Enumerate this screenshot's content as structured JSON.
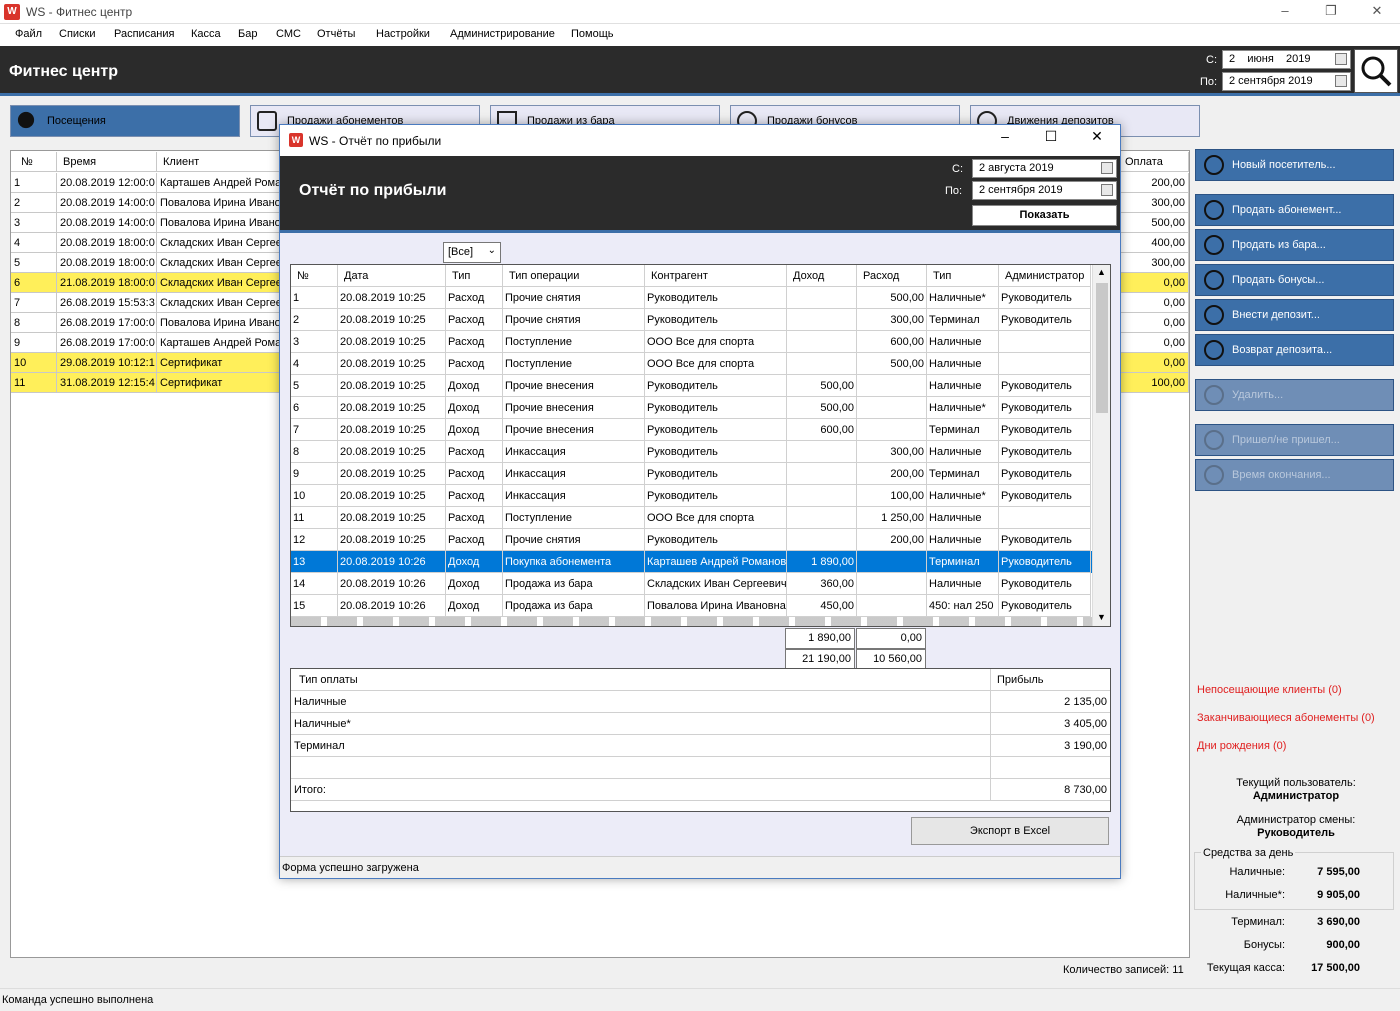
{
  "window": {
    "title": "WS - Фитнес центр",
    "logo": "W"
  },
  "menu": [
    "Файл",
    "Списки",
    "Расписания",
    "Касса",
    "Бар",
    "СМС",
    "Отчёты",
    "Настройки",
    "Администрирование",
    "Помощь"
  ],
  "header": {
    "title": "Фитнес центр",
    "from_label": "С:",
    "to_label": "По:",
    "from_day": "2",
    "from_month": "июня",
    "from_year": "2019",
    "to_date": "2 сентября 2019",
    "search_icon": "search-icon"
  },
  "tabs": [
    {
      "label": "Посещения",
      "icon": "visitor-icon",
      "active": true
    },
    {
      "label": "Продажи абонементов",
      "icon": "membership-card-icon"
    },
    {
      "label": "Продажи из бара",
      "icon": "coffee-cup-icon"
    },
    {
      "label": "Продажи бонусов",
      "icon": "dollar-coin-icon"
    },
    {
      "label": "Движения депозитов",
      "icon": "dollar-coin-icon"
    }
  ],
  "main_table": {
    "headers": [
      "№",
      "Время",
      "Клиент",
      "Оплата"
    ],
    "rows": [
      {
        "n": "1",
        "time": "20.08.2019 12:00:0",
        "client": "Карташев Андрей Рома",
        "pay": "200,00",
        "hl": false
      },
      {
        "n": "2",
        "time": "20.08.2019 14:00:0",
        "client": "Повалова Ирина Ивано",
        "pay": "300,00",
        "hl": false
      },
      {
        "n": "3",
        "time": "20.08.2019 14:00:0",
        "client": "Повалова Ирина Ивано",
        "pay": "500,00",
        "hl": false
      },
      {
        "n": "4",
        "time": "20.08.2019 18:00:0",
        "client": "Складских Иван Сергее",
        "pay": "400,00",
        "hl": false
      },
      {
        "n": "5",
        "time": "20.08.2019 18:00:0",
        "client": "Складских Иван Сергее",
        "pay": "300,00",
        "hl": false
      },
      {
        "n": "6",
        "time": "21.08.2019 18:00:0",
        "client": "Складских Иван Сергее",
        "pay": "0,00",
        "hl": true
      },
      {
        "n": "7",
        "time": "26.08.2019 15:53:3",
        "client": "Складских Иван Сергее",
        "pay": "0,00",
        "hl": false
      },
      {
        "n": "8",
        "time": "26.08.2019 17:00:0",
        "client": "Повалова Ирина Ивано",
        "pay": "0,00",
        "hl": false
      },
      {
        "n": "9",
        "time": "26.08.2019 17:00:0",
        "client": "Карташев Андрей Рома",
        "pay": "0,00",
        "hl": false
      },
      {
        "n": "10",
        "time": "29.08.2019 10:12:1",
        "client": "Сертификат",
        "pay": "0,00",
        "hl": true
      },
      {
        "n": "11",
        "time": "31.08.2019 12:15:4",
        "client": "Сертификат",
        "pay": "100,00",
        "hl": true
      }
    ],
    "record_count": "Количество записей: 11"
  },
  "sidebar": {
    "buttons": [
      {
        "label": "Новый посетитель...",
        "icon": "visitor-icon",
        "enabled": true
      },
      {
        "label": "Продать абонемент...",
        "icon": "membership-card-icon",
        "enabled": true
      },
      {
        "label": "Продать из бара...",
        "icon": "coffee-cup-icon",
        "enabled": true
      },
      {
        "label": "Продать бонусы...",
        "icon": "dollar-coin-icon",
        "enabled": true
      },
      {
        "label": "Внести депозит...",
        "icon": "deposit-in-icon",
        "enabled": true
      },
      {
        "label": "Возврат депозита...",
        "icon": "deposit-out-icon",
        "enabled": true
      },
      {
        "label": "Удалить...",
        "icon": "trash-icon",
        "enabled": false
      },
      {
        "label": "Пришел/не пришел...",
        "icon": "question-person-icon",
        "enabled": false
      },
      {
        "label": "Время окончания...",
        "icon": "clock-icon",
        "enabled": false
      }
    ],
    "links": [
      "Непосещающие клиенты (0)",
      "Заканчивающиеся абонементы (0)",
      "Дни рождения (0)"
    ],
    "user_label": "Текущий пользователь:",
    "user": "Администратор",
    "shift_label": "Администратор смены:",
    "shift_admin": "Руководитель",
    "funds_title": "Средства за день",
    "funds": [
      {
        "label": "Наличные:",
        "value": "7 595,00"
      },
      {
        "label": "Наличные*:",
        "value": "9 905,00"
      },
      {
        "label": "Терминал:",
        "value": "3 690,00"
      },
      {
        "label": "Бонусы:",
        "value": "900,00"
      },
      {
        "label": "Текущая касса:",
        "value": "17 500,00"
      }
    ]
  },
  "status": "Команда успешно выполнена",
  "dialog": {
    "title": "WS - Отчёт по прибыли",
    "heading": "Отчёт по прибыли",
    "from_label": "С:",
    "to_label": "По:",
    "from_date": "2  августа  2019",
    "to_date": "2 сентября 2019",
    "show_button": "Показать",
    "filter": "[Все]",
    "headers": [
      "№",
      "Дата",
      "Тип",
      "Тип операции",
      "Контрагент",
      "Доход",
      "Расход",
      "Тип",
      "Администратор"
    ],
    "rows": [
      [
        "1",
        "20.08.2019 10:25",
        "Расход",
        "Прочие снятия",
        "Руководитель",
        "",
        "500,00",
        "Наличные*",
        "Руководитель"
      ],
      [
        "2",
        "20.08.2019 10:25",
        "Расход",
        "Прочие снятия",
        "Руководитель",
        "",
        "300,00",
        "Терминал",
        "Руководитель"
      ],
      [
        "3",
        "20.08.2019 10:25",
        "Расход",
        "Поступление",
        "ООО Все для спорта",
        "",
        "600,00",
        "Наличные",
        ""
      ],
      [
        "4",
        "20.08.2019 10:25",
        "Расход",
        "Поступление",
        "ООО Все для спорта",
        "",
        "500,00",
        "Наличные",
        ""
      ],
      [
        "5",
        "20.08.2019 10:25",
        "Доход",
        "Прочие внесения",
        "Руководитель",
        "500,00",
        "",
        "Наличные",
        "Руководитель"
      ],
      [
        "6",
        "20.08.2019 10:25",
        "Доход",
        "Прочие внесения",
        "Руководитель",
        "500,00",
        "",
        "Наличные*",
        "Руководитель"
      ],
      [
        "7",
        "20.08.2019 10:25",
        "Доход",
        "Прочие внесения",
        "Руководитель",
        "600,00",
        "",
        "Терминал",
        "Руководитель"
      ],
      [
        "8",
        "20.08.2019 10:25",
        "Расход",
        "Инкассация",
        "Руководитель",
        "",
        "300,00",
        "Наличные",
        "Руководитель"
      ],
      [
        "9",
        "20.08.2019 10:25",
        "Расход",
        "Инкассация",
        "Руководитель",
        "",
        "200,00",
        "Терминал",
        "Руководитель"
      ],
      [
        "10",
        "20.08.2019 10:25",
        "Расход",
        "Инкассация",
        "Руководитель",
        "",
        "100,00",
        "Наличные*",
        "Руководитель"
      ],
      [
        "11",
        "20.08.2019 10:25",
        "Расход",
        "Поступление",
        "ООО Все для спорта",
        "",
        "1 250,00",
        "Наличные",
        ""
      ],
      [
        "12",
        "20.08.2019 10:25",
        "Расход",
        "Прочие снятия",
        "Руководитель",
        "",
        "200,00",
        "Наличные",
        "Руководитель"
      ],
      [
        "13",
        "20.08.2019 10:26",
        "Доход",
        "Покупка абонемента",
        "Карташев Андрей Романов",
        "1 890,00",
        "",
        "Терминал",
        "Руководитель"
      ],
      [
        "14",
        "20.08.2019 10:26",
        "Доход",
        "Продажа из бара",
        "Складских Иван Сергеевич",
        "360,00",
        "",
        "Наличные",
        "Руководитель"
      ],
      [
        "15",
        "20.08.2019 10:26",
        "Доход",
        "Продажа из бара",
        "Повалова Ирина Ивановна",
        "450,00",
        "",
        "450: нал 250",
        "Руководитель"
      ]
    ],
    "selected_row": 12,
    "totals": {
      "sel_income": "1 890,00",
      "sel_expense": "0,00",
      "income": "21 190,00",
      "expense": "10 560,00"
    },
    "pay_headers": [
      "Тип оплаты",
      "Прибыль"
    ],
    "pay_rows": [
      {
        "type": "Наличные",
        "profit": "2 135,00"
      },
      {
        "type": "Наличные*",
        "profit": "3 405,00"
      },
      {
        "type": "Терминал",
        "profit": "3 190,00"
      },
      {
        "type": "",
        "profit": ""
      },
      {
        "type": "Итого:",
        "profit": "8 730,00"
      }
    ],
    "export_button": "Экспорт в Excel",
    "status": "Форма успешно загружена"
  }
}
